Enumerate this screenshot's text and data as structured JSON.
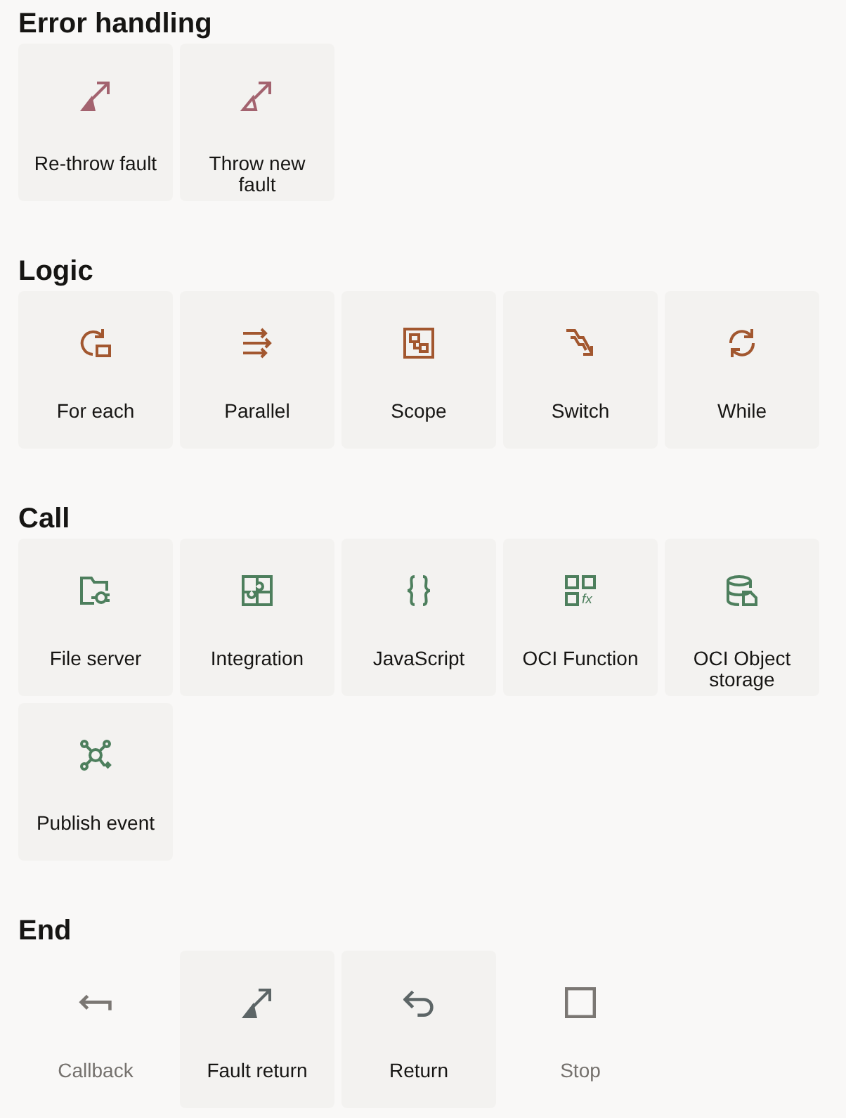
{
  "sections": [
    {
      "title": "Error handling",
      "color": "#a3636f",
      "items": [
        {
          "label": "Re-throw fault",
          "kind": "rethrow",
          "disabled": false
        },
        {
          "label": "Throw new fault",
          "kind": "throw",
          "disabled": false
        }
      ]
    },
    {
      "title": "Logic",
      "color": "#a2572f",
      "items": [
        {
          "label": "For each",
          "kind": "foreach",
          "disabled": false
        },
        {
          "label": "Parallel",
          "kind": "parallel",
          "disabled": false
        },
        {
          "label": "Scope",
          "kind": "scope",
          "disabled": false
        },
        {
          "label": "Switch",
          "kind": "switch",
          "disabled": false
        },
        {
          "label": "While",
          "kind": "while",
          "disabled": false
        }
      ]
    },
    {
      "title": "Call",
      "color": "#4d7f5d",
      "items": [
        {
          "label": "File server",
          "kind": "fileserver",
          "disabled": false
        },
        {
          "label": "Integration",
          "kind": "integration",
          "disabled": false
        },
        {
          "label": "JavaScript",
          "kind": "javascript",
          "disabled": false
        },
        {
          "label": "OCI Function",
          "kind": "function",
          "glyph": "fx",
          "disabled": false
        },
        {
          "label": "OCI Object storage",
          "kind": "storage",
          "disabled": false
        },
        {
          "label": "Publish event",
          "kind": "publish",
          "disabled": false
        }
      ]
    },
    {
      "title": "End",
      "color": "#5c6566",
      "items": [
        {
          "label": "Callback",
          "kind": "callback",
          "disabled": true
        },
        {
          "label": "Fault return",
          "kind": "rethrow",
          "disabled": false
        },
        {
          "label": "Return",
          "kind": "return",
          "disabled": false
        },
        {
          "label": "Stop",
          "kind": "stop",
          "disabled": true
        }
      ]
    }
  ]
}
